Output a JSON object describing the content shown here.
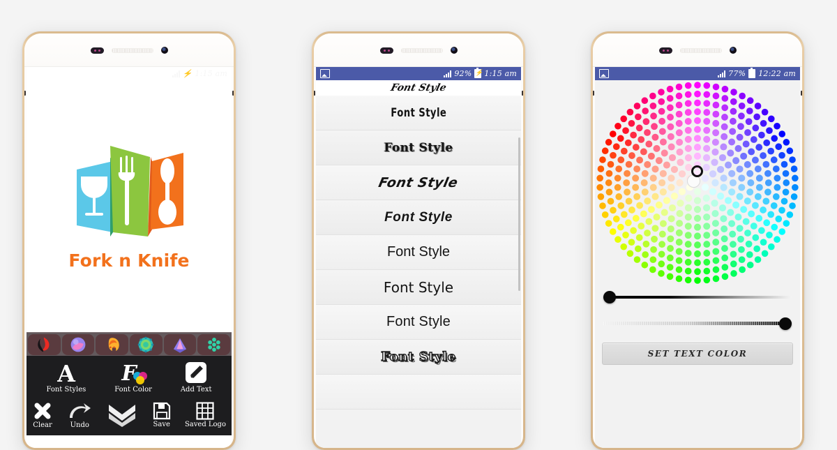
{
  "background_color": "#f4f4f4",
  "phones": [
    {
      "id": "phone-logo-editor",
      "statusbar": {
        "style": "transparent",
        "battery": "",
        "time": "1:15 am",
        "charging_icon": "bolt-icon"
      },
      "logo": {
        "title": "Fork n Knife",
        "title_color": "#f2711c",
        "panel_colors": [
          "#5bc8e8",
          "#8cc63f",
          "#f2711c"
        ],
        "icons": [
          "wine-glass-icon",
          "fork-icon",
          "spoon-icon"
        ]
      },
      "effects_bar": {
        "label": "effects-strip",
        "swatches": [
          {
            "name": "effect-red-leaf",
            "colors": [
              "#e8332a",
              "#151515"
            ]
          },
          {
            "name": "effect-violet-orb",
            "colors": [
              "#8e7ce8",
              "#e96fc0"
            ]
          },
          {
            "name": "effect-orange-face",
            "colors": [
              "#ffb02e",
              "#f26a1b"
            ]
          },
          {
            "name": "effect-teal-mandala",
            "colors": [
              "#2ecfc0",
              "#7fd86a"
            ]
          },
          {
            "name": "effect-pink-crown",
            "colors": [
              "#b98bf0",
              "#ef8fd0"
            ]
          },
          {
            "name": "effect-green-hex",
            "colors": [
              "#2fd3a8",
              "#34c0bf"
            ]
          }
        ]
      },
      "toolbar": {
        "row1": [
          {
            "label": "Font Styles",
            "icon": "letter-a-icon"
          },
          {
            "label": "Font Color",
            "icon": "letter-f-color-icon"
          },
          {
            "label": "Add Text",
            "icon": "pencil-icon"
          }
        ],
        "row2": [
          {
            "label": "Clear",
            "icon": "cross-icon"
          },
          {
            "label": "Undo",
            "icon": "undo-arrow-icon"
          },
          {
            "label": "",
            "icon": "double-chevron-down-icon"
          },
          {
            "label": "Save",
            "icon": "floppy-disk-icon"
          },
          {
            "label": "Saved Logo",
            "icon": "grid-icon"
          }
        ]
      }
    },
    {
      "id": "phone-font-styles",
      "statusbar": {
        "style": "blue",
        "color": "#4b5aa8",
        "left_icon": "gallery-icon",
        "battery": "92%",
        "battery_icon": "battery-charging-icon",
        "time": "1:15 am",
        "signal_icon": "signal-bars-icon"
      },
      "partial_top_row": "Font Style",
      "font_rows": [
        "Font Style",
        "Font Style",
        "Font Style",
        "Font Style",
        "Font Style",
        "Font Style",
        "Font Style",
        "Font Style"
      ]
    },
    {
      "id": "phone-color-picker",
      "statusbar": {
        "style": "blue",
        "color": "#4b5aa8",
        "left_icon": "gallery-icon",
        "battery": "77%",
        "battery_icon": "battery-icon",
        "time": "12:22 am",
        "signal_icon": "signal-bars-icon"
      },
      "color_wheel": {
        "name": "hsv-dot-color-wheel",
        "selector": "color-selector-ring",
        "rings": 11,
        "selected_preview": "#fbfbfb"
      },
      "sliders": [
        {
          "name": "brightness-slider",
          "value_position": "left",
          "handle": "slider-handle"
        },
        {
          "name": "alpha-slider",
          "value_position": "right",
          "handle": "slider-handle"
        }
      ],
      "button": {
        "label": "SET TEXT COLOR",
        "name": "set-text-color-button"
      }
    }
  ]
}
